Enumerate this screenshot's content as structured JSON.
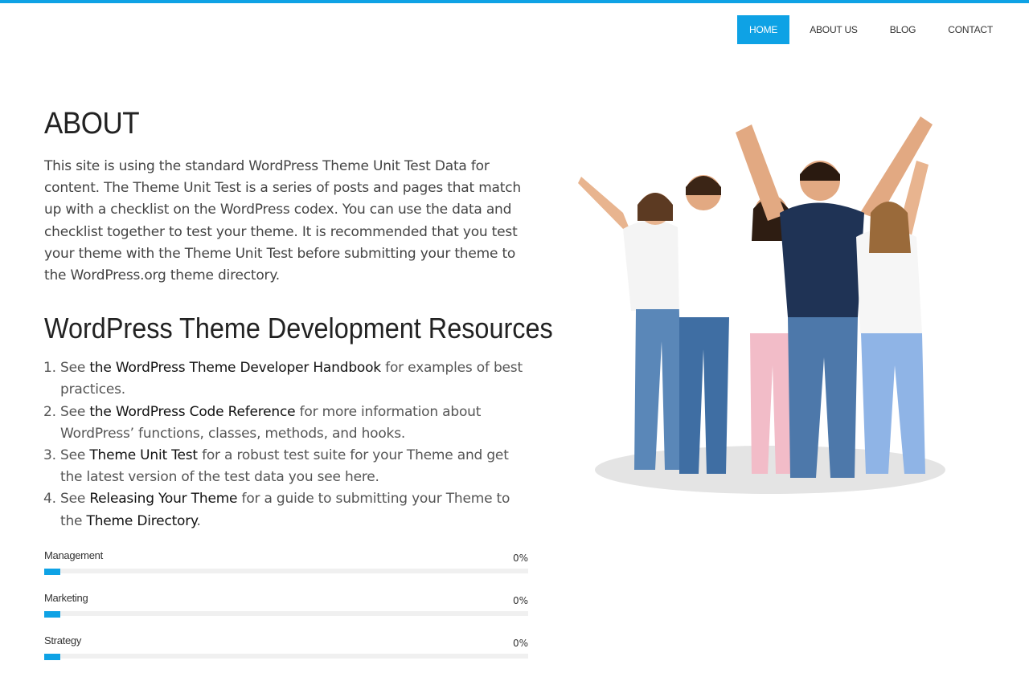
{
  "nav": {
    "items": [
      {
        "label": "HOME",
        "active": true
      },
      {
        "label": "ABOUT US",
        "active": false
      },
      {
        "label": "BLOG",
        "active": false
      },
      {
        "label": "CONTACT",
        "active": false
      }
    ]
  },
  "page": {
    "title": "ABOUT",
    "intro": "This site is using the standard WordPress Theme Unit Test Data for content. The Theme Unit Test is a series of posts and pages that match up with a checklist on the WordPress codex. You can use the data and checklist together to test your theme. It is recommended that you test your theme with the Theme Unit Test before submitting your theme to the WordPress.org theme directory.",
    "section_title": "WordPress Theme Development Resources",
    "resources": [
      {
        "prefix": "See ",
        "link": "the WordPress Theme Developer Handbook",
        "suffix": " for examples of best practices."
      },
      {
        "prefix": "See ",
        "link": "the WordPress Code Reference",
        "suffix": " for more information about WordPress’ functions, classes, methods, and hooks."
      },
      {
        "prefix": "See ",
        "link": "Theme Unit Test",
        "suffix": " for a robust test suite for your Theme and get the latest version of the test data you see here."
      },
      {
        "prefix": "See ",
        "link": "Releasing Your Theme",
        "suffix": " for a guide to submitting your Theme to the ",
        "link2": "Theme Directory",
        "suffix2": "."
      }
    ]
  },
  "skills": [
    {
      "name": "Management",
      "percent_label": "0%",
      "value": 0
    },
    {
      "name": "Marketing",
      "percent_label": "0%",
      "value": 0
    },
    {
      "name": "Strategy",
      "percent_label": "0%",
      "value": 0
    }
  ],
  "colors": {
    "accent": "#0ea2e5"
  },
  "hero_image": {
    "subject": "group of five cheering people"
  }
}
